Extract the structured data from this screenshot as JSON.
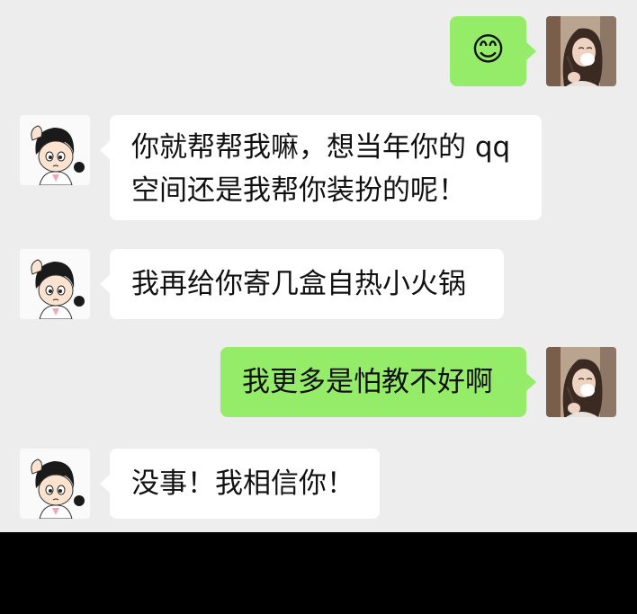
{
  "messages": [
    {
      "side": "out",
      "emoji": "😊",
      "emoji_name": "smiling-face-emoji"
    },
    {
      "side": "in",
      "lines": [
        "你就帮帮我嘛，想当年你的 qq",
        "空间还是我帮你装扮的呢！"
      ]
    },
    {
      "side": "in",
      "lines": [
        "我再给你寄几盒自热小火锅"
      ]
    },
    {
      "side": "out",
      "lines": [
        "我更多是怕教不好啊"
      ]
    },
    {
      "side": "in",
      "lines": [
        "没事！我相信你！"
      ]
    }
  ],
  "avatars": {
    "incoming": "cartoon-girl-avatar",
    "outgoing": "woman-photo-avatar"
  },
  "colors": {
    "background": "#ededed",
    "incoming_bubble": "#ffffff",
    "outgoing_bubble": "#95ec69",
    "text": "#111111"
  }
}
